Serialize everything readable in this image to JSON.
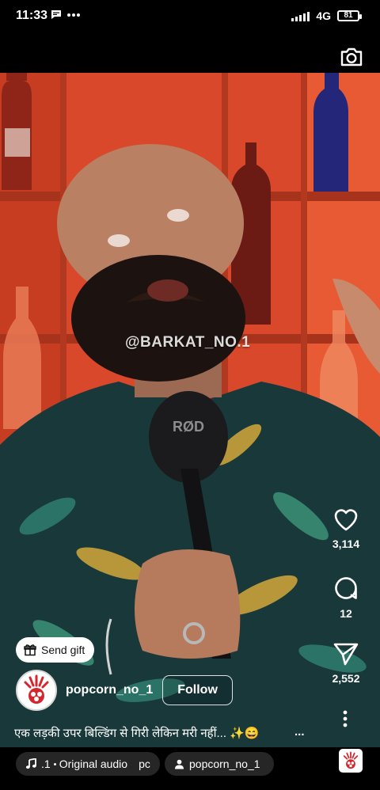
{
  "status_bar": {
    "time": "11:33",
    "network": "4G",
    "battery": "81"
  },
  "video": {
    "watermark": "@BARKAT_NO.1"
  },
  "actions": {
    "likes": "3,114",
    "comments": "12",
    "shares": "2,552"
  },
  "gift": {
    "label": "Send gift"
  },
  "author": {
    "username": "popcorn_no_1",
    "follow_label": "Follow"
  },
  "caption": {
    "text": "एक लड़की उपर बिल्डिंग से गिरी लेकिन मरी नहीं... ✨😄",
    "more": "..."
  },
  "audio": {
    "count": ".1",
    "title": "Original audio",
    "overflow": "pc",
    "user": "popcorn_no_1"
  },
  "colors": {
    "accent_red": "#d4262c",
    "chip_bg": "#262626"
  }
}
